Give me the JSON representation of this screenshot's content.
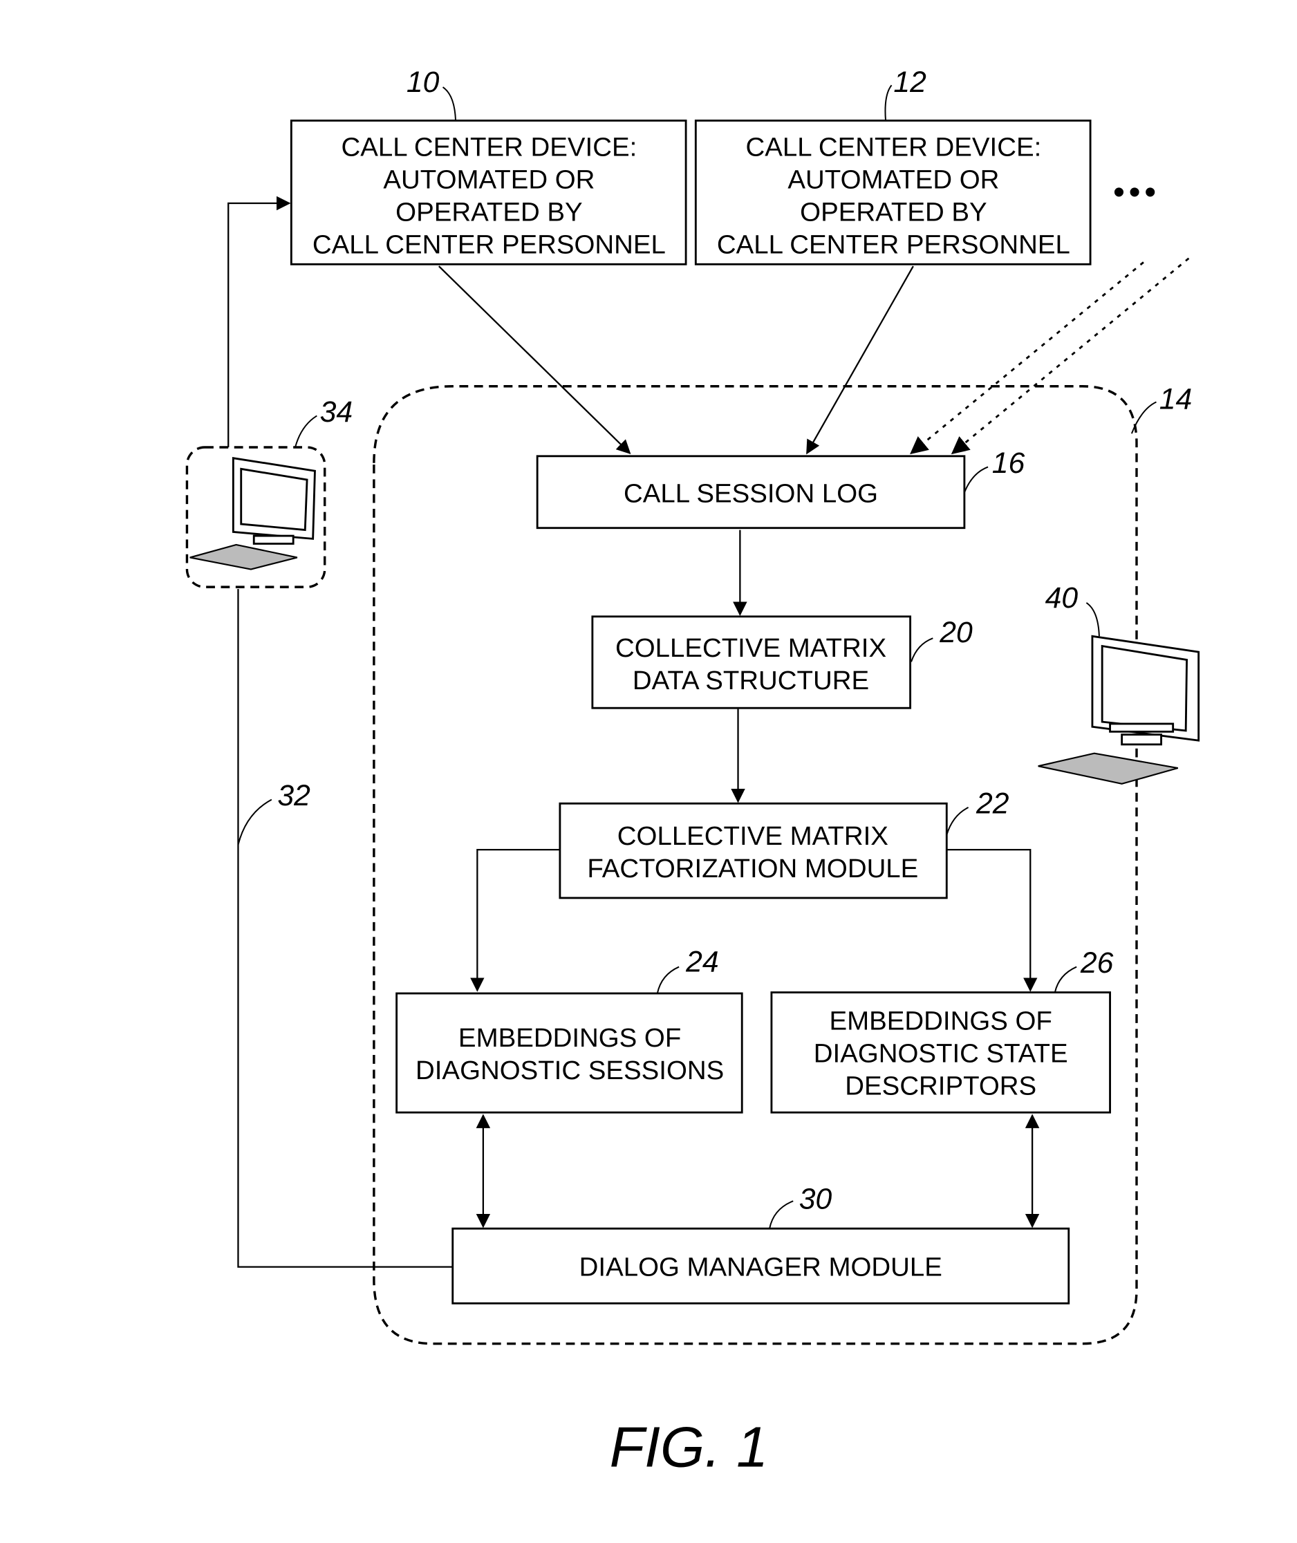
{
  "figure": {
    "caption": "FIG. 1",
    "boxes": {
      "device_10": {
        "ref": "10",
        "lines": [
          "CALL CENTER DEVICE:",
          "AUTOMATED OR",
          "OPERATED BY",
          "CALL CENTER PERSONNEL"
        ]
      },
      "device_12": {
        "ref": "12",
        "lines": [
          "CALL CENTER DEVICE:",
          "AUTOMATED OR",
          "OPERATED BY",
          "CALL CENTER PERSONNEL"
        ]
      },
      "call_session_log": {
        "ref": "16",
        "lines": [
          "CALL SESSION LOG"
        ]
      },
      "matrix_data_structure": {
        "ref": "20",
        "lines": [
          "COLLECTIVE MATRIX",
          "DATA STRUCTURE"
        ]
      },
      "factorization_module": {
        "ref": "22",
        "lines": [
          "COLLECTIVE MATRIX",
          "FACTORIZATION MODULE"
        ]
      },
      "session_embeddings": {
        "ref": "24",
        "lines": [
          "EMBEDDINGS OF",
          "DIAGNOSTIC SESSIONS"
        ]
      },
      "state_embeddings": {
        "ref": "26",
        "lines": [
          "EMBEDDINGS OF",
          "DIAGNOSTIC STATE",
          "DESCRIPTORS"
        ]
      },
      "dialog_manager": {
        "ref": "30",
        "lines": [
          "DIALOG MANAGER MODULE"
        ]
      }
    },
    "refs": {
      "system_boundary": "14",
      "connection": "32",
      "client_computer": "34",
      "server_computer": "40"
    },
    "ellipsis": "•••"
  }
}
